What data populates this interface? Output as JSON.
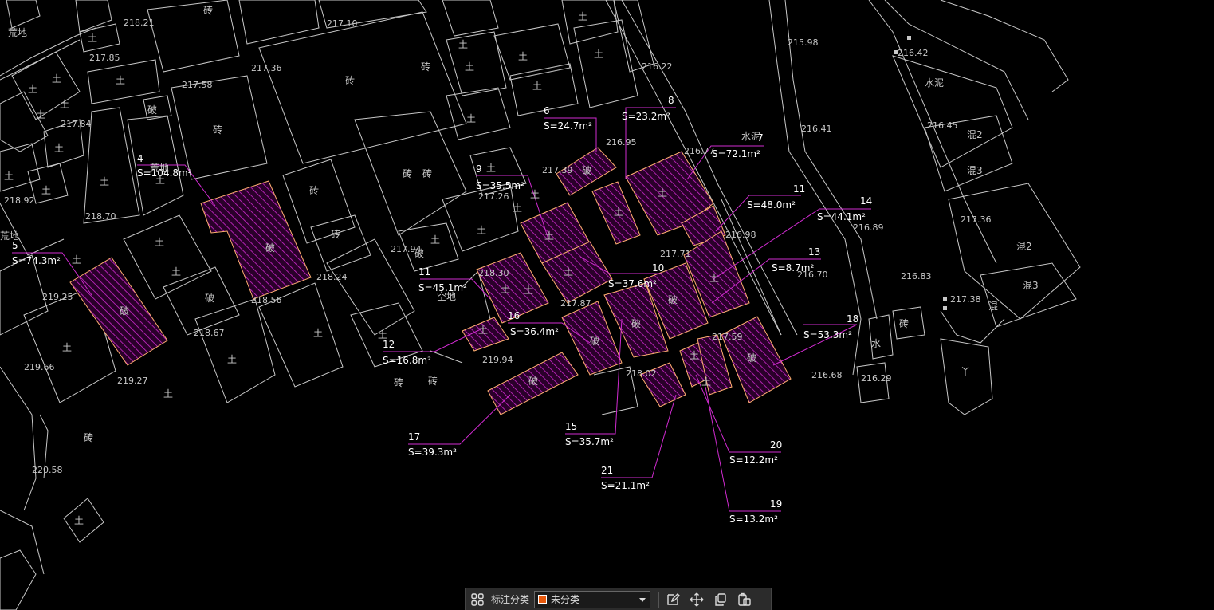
{
  "toolbar": {
    "annotation_label": "标注分类",
    "category_selected": "未分类",
    "category_color": "#e8590c",
    "icons": [
      "grid-icon",
      "chevron-down-icon",
      "edit-icon",
      "move-icon",
      "copy-icon",
      "paste-icon"
    ]
  },
  "colors": {
    "background": "#000000",
    "linework": "#c8c8c8",
    "leader": "#d02bd0",
    "hatch": "#d02bd0",
    "parcel_border": "#ffb070",
    "label_text": "#ffffff"
  },
  "parcel_labels": [
    {
      "id": "4",
      "area": "S=104.8m²"
    },
    {
      "id": "5",
      "area": "S=74.3m²"
    },
    {
      "id": "6",
      "area": "S=24.7m²"
    },
    {
      "id": "8",
      "area": "S=23.2m²"
    },
    {
      "id": "7",
      "area": "S=72.1m²"
    },
    {
      "id": "9",
      "area": "S=35.5m²"
    },
    {
      "id": "11",
      "area": "S=48.0m²"
    },
    {
      "id": "14",
      "area": "S=44.1m²"
    },
    {
      "id": "13",
      "area": "S=8.7m²"
    },
    {
      "id": "10",
      "area": "S=37.6m²"
    },
    {
      "id": "11",
      "area": "S=45.1m²"
    },
    {
      "id": "16",
      "area": "S=36.4m²"
    },
    {
      "id": "12",
      "area": "S=16.8m²"
    },
    {
      "id": "18",
      "area": "S=53.3m²"
    },
    {
      "id": "17",
      "area": "S=39.3m²"
    },
    {
      "id": "15",
      "area": "S=35.7m²"
    },
    {
      "id": "20",
      "area": "S=12.2m²"
    },
    {
      "id": "21",
      "area": "S=21.1m²"
    },
    {
      "id": "19",
      "area": "S=13.2m²"
    }
  ],
  "elevations": [
    "218.21",
    "217.10",
    "217.85",
    "217.36",
    "217.58",
    "217.84",
    "218.92",
    "218.70",
    "219.25",
    "219.66",
    "219.27",
    "218.67",
    "218.56",
    "218.24",
    "220.58",
    "216.22",
    "215.98",
    "216.42",
    "216.95",
    "216.77",
    "217.39",
    "217.26",
    "216.41",
    "216.45",
    "216.98",
    "216.89",
    "217.36",
    "217.71",
    "216.70",
    "216.83",
    "217.38",
    "217.94",
    "218.30",
    "217.87",
    "219.94",
    "217.59",
    "218.02",
    "216.68",
    "216.29"
  ],
  "material_marks": [
    "荒地",
    "砖",
    "土",
    "破",
    "水泥",
    "混2",
    "混3",
    "混",
    "空地",
    "水",
    "丫"
  ]
}
